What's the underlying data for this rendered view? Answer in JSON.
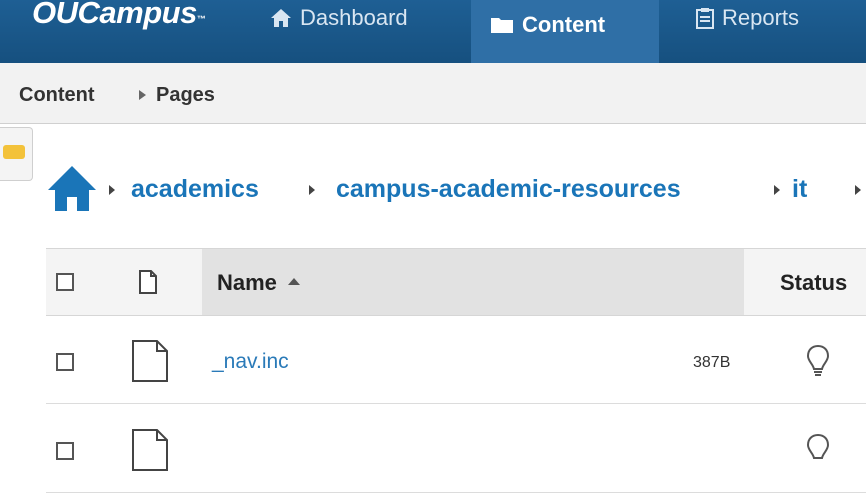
{
  "app": {
    "logo_text": "OUCampus",
    "logo_tm": "™"
  },
  "nav": {
    "dashboard_label": "Dashboard",
    "content_label": "Content",
    "reports_label": "Reports",
    "active": "Content"
  },
  "breadcrumb": {
    "section": "Content",
    "page": "Pages"
  },
  "path": {
    "segments": [
      "academics",
      "campus-academic-resources",
      "it"
    ]
  },
  "table": {
    "columns": {
      "name": "Name",
      "status": "Status"
    },
    "sort": "Name ascending",
    "rows": [
      {
        "name": "_nav.inc",
        "size": "387B",
        "status_icon": "lightbulb-icon"
      },
      {
        "name": "",
        "size": "",
        "status_icon": "lightbulb-icon"
      }
    ]
  },
  "colors": {
    "nav_bg": "#16507f",
    "nav_active_bg": "#2f6fa6",
    "link": "#1a75b8",
    "folder": "#f3c23a"
  }
}
